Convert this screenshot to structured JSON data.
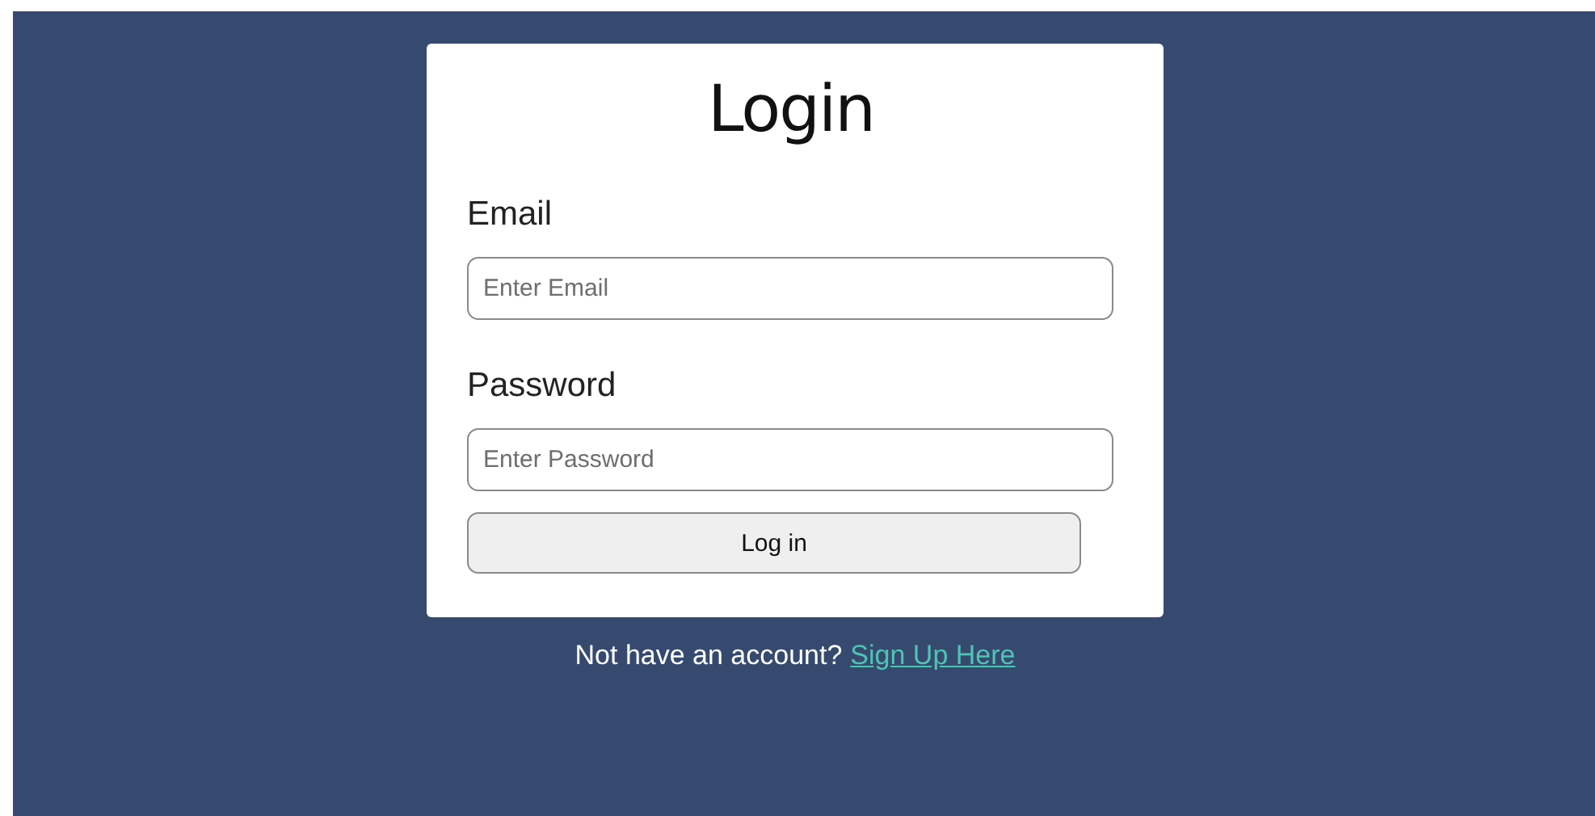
{
  "title": "Login",
  "fields": [
    {
      "label": "Email",
      "placeholder": "Enter Email"
    },
    {
      "label": "Password",
      "placeholder": "Enter Password"
    }
  ],
  "submit": "Log in",
  "footer": {
    "text": "Not have an account?",
    "link": "Sign Up Here"
  }
}
